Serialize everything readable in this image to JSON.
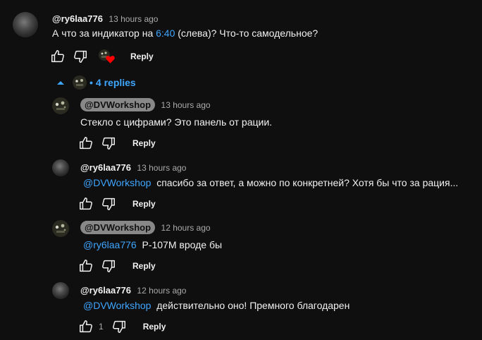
{
  "top_comment": {
    "author": "@ry6laa776",
    "time": "13 hours ago",
    "text_before": "А что за индикатор на ",
    "timestamp_link": "6:40",
    "text_after": " (слева)? Что-то самодельное?",
    "reply_label": "Reply",
    "creator_heart": true
  },
  "replies_toggle": {
    "label": "4 replies"
  },
  "replies": [
    {
      "author": "@DVWorkshop",
      "is_creator": true,
      "time": "13 hours ago",
      "mention": "",
      "text": "Стекло с цифрами? Это панель от рации.",
      "likes": "",
      "reply_label": "Reply"
    },
    {
      "author": "@ry6laa776",
      "is_creator": false,
      "time": "13 hours ago",
      "mention": "@DVWorkshop",
      "text": "спасибо за ответ, а можно по конкретней? Хотя бы что за рация...",
      "likes": "",
      "reply_label": "Reply"
    },
    {
      "author": "@DVWorkshop",
      "is_creator": true,
      "time": "12 hours ago",
      "mention": "@ry6laa776",
      "text": "Р-107М вроде бы",
      "likes": "",
      "reply_label": "Reply"
    },
    {
      "author": "@ry6laa776",
      "is_creator": false,
      "time": "12 hours ago",
      "mention": "@DVWorkshop",
      "text": "действительно оно! Премного благодарен",
      "likes": "1",
      "reply_label": "Reply"
    }
  ],
  "colors": {
    "background": "#0f0f0f",
    "link": "#3ea6ff",
    "creator_badge": "#888888",
    "heart": "#ff0000"
  }
}
